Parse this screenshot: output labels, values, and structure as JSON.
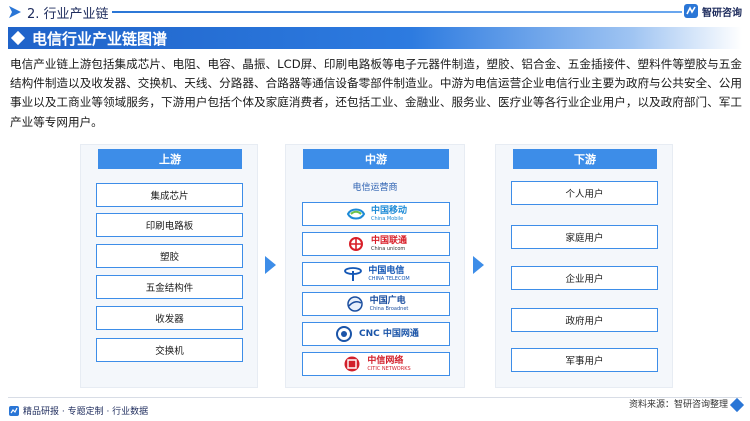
{
  "header": {
    "section_title": "2. 行业产业链",
    "brand_name": "智研咨询"
  },
  "banner": {
    "title": "电信行业产业链图谱"
  },
  "description": "电信产业链上游包括集成芯片、电阻、电容、晶振、LCD屏、印刷电路板等电子元器件制造，塑胶、铝合金、五金插接件、塑料件等塑胶与五金结构件制造以及收发器、交换机、天线、分路器、合路器等通信设备零部件制造业。中游为电信运营企业电信行业主要为政府与公共安全、公用事业以及工商业等领域服务，下游用户包括个体及家庭消费者，还包括工业、金融业、服务业、医疗业等各行业企业用户，以及政府部门、军工产业等专网用户。",
  "upstream": {
    "label": "上游",
    "items": [
      "集成芯片",
      "印刷电路板",
      "塑胶",
      "五金结构件",
      "收发器",
      "交换机"
    ]
  },
  "midstream": {
    "label": "中游",
    "caption": "电信运营商",
    "operators": [
      {
        "cn": "中国移动",
        "en": "China Mobile",
        "color": "#1c8ad6",
        "icon": "china-mobile-logo"
      },
      {
        "cn": "中国联通",
        "en": "China unicom",
        "color": "#d81e28",
        "icon": "china-unicom-logo"
      },
      {
        "cn": "中国电信",
        "en": "CHINA TELECOM",
        "color": "#1457b5",
        "icon": "china-telecom-logo"
      },
      {
        "cn": "中国广电",
        "en": "China Broadnet",
        "color": "#1a4d9e",
        "icon": "china-broadnet-logo"
      },
      {
        "cn": "CNC 中国网通",
        "en": "",
        "color": "#1a54a8",
        "icon": "cnc-logo"
      },
      {
        "cn": "中信网络",
        "en": "CITIC NETWORKS",
        "color": "#d2202b",
        "icon": "citic-networks-logo"
      }
    ]
  },
  "downstream": {
    "label": "下游",
    "items": [
      "个人用户",
      "家庭用户",
      "企业用户",
      "政府用户",
      "军事用户"
    ]
  },
  "footer": {
    "tagline": "精品研报 · 专题定制 · 行业数据",
    "source": "资料来源：智研咨询整理"
  },
  "colors": {
    "accent": "#3d8de8",
    "brand_dark": "#1d2b5c",
    "banner": "#1f63c9"
  }
}
